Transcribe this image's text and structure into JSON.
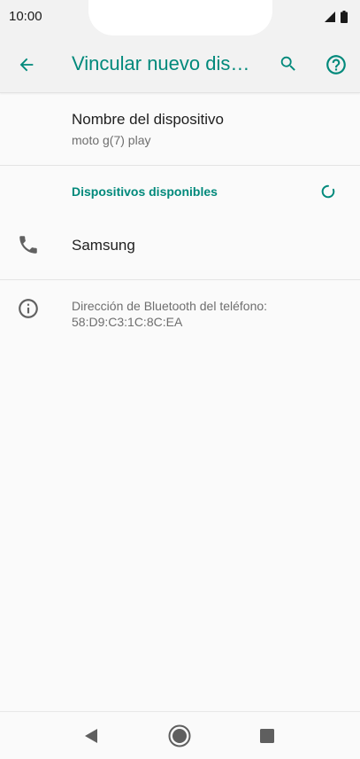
{
  "status_bar": {
    "time": "10:00",
    "icons": [
      "signal-icon",
      "battery-icon"
    ]
  },
  "app_bar": {
    "title": "Vincular nuevo dis…",
    "back_icon": "arrow-back-icon",
    "search_icon": "search-icon",
    "help_icon": "help-circle-icon",
    "accent_color": "#00897b"
  },
  "device_name": {
    "title": "Nombre del dispositivo",
    "value": "moto g(7) play"
  },
  "available_devices": {
    "header": "Dispositivos disponibles",
    "spinner_icon": "loading-spinner-icon",
    "items": [
      {
        "label": "Samsung",
        "icon": "phone-icon"
      }
    ]
  },
  "bluetooth_info": {
    "icon": "info-icon",
    "line1": "Dirección de Bluetooth del teléfono:",
    "line2": "58:D9:C3:1C:8C:EA"
  },
  "nav_bar": {
    "back": "nav-back-icon",
    "home": "nav-home-icon",
    "recents": "nav-recents-icon"
  }
}
